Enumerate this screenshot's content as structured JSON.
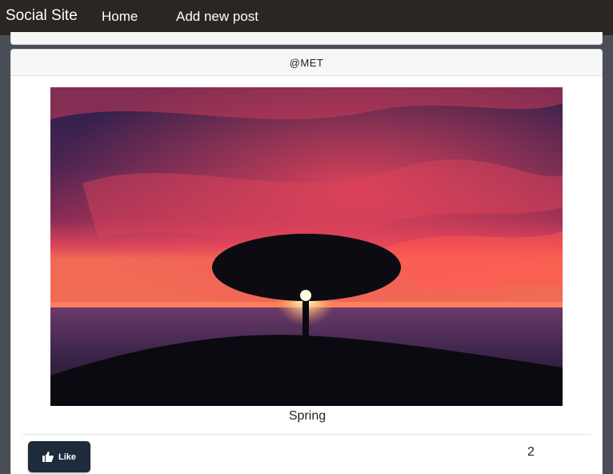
{
  "nav": {
    "brand": "Social Site",
    "home": "Home",
    "add_post": "Add new post"
  },
  "post": {
    "author": "@MET",
    "caption": "Spring",
    "like_label": "Like",
    "like_count": "2",
    "image_icon": "sunset-tree-photo",
    "like_icon": "thumbs-up-icon"
  },
  "colors": {
    "navbar": "#2c2623",
    "page_background": "#4a4f57",
    "like_button": "#1e2b3a"
  }
}
